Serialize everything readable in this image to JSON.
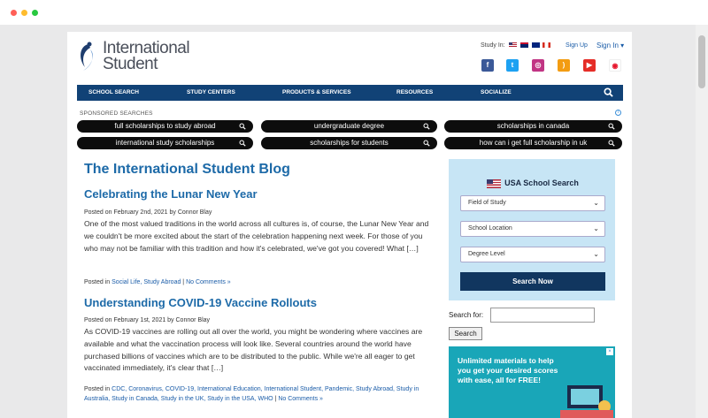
{
  "header": {
    "logo_line1": "International",
    "logo_line2": "Student",
    "study_in_label": "Study In:",
    "sign_up": "Sign Up",
    "sign_in": "Sign In ▾",
    "social": [
      "facebook-icon",
      "twitter-icon",
      "instagram-icon",
      "rss-icon",
      "youtube-icon",
      "weibo-icon"
    ]
  },
  "nav": {
    "items": [
      "SCHOOL SEARCH",
      "STUDY CENTERS",
      "PRODUCTS & SERVICES",
      "RESOURCES",
      "SOCIALIZE"
    ]
  },
  "sponsored": {
    "label": "SPONSORED SEARCHES",
    "pills": [
      "full scholarships to study abroad",
      "undergraduate degree",
      "scholarships in canada",
      "international study scholarships",
      "scholarships for students",
      "how can i get full scholarship in uk"
    ]
  },
  "blog": {
    "title": "The International Student Blog",
    "posts": [
      {
        "title": "Celebrating the Lunar New Year",
        "meta": "Posted on February 2nd, 2021 by Connor Blay",
        "body": "One of the most valued traditions in the world across all cultures is, of course, the Lunar New Year and we couldn't be more excited about the start of the celebration happening next week. For those of you who may not be familiar with this tradition and how it's celebrated, we've got you covered! What […]",
        "posted_in": "Posted in",
        "categories": "Social Life, Study Abroad",
        "comments": "No Comments »"
      },
      {
        "title": "Understanding COVID-19 Vaccine Rollouts",
        "meta": "Posted on February 1st, 2021 by Connor Blay",
        "body": "As COVID-19 vaccines are rolling out all over the world, you might be wondering where vaccines are available and what the vaccination process will look like. Several countries around the world have purchased billions of vaccines which are to be distributed to the public. While we're all eager to get vaccinated immediately, it's clear that […]",
        "posted_in": "Posted in",
        "categories": "CDC, Coronavirus, COVID-19, International Education, International Student, Pandemic, Study Abroad, Study in Australia, Study in Canada, Study in the UK, Study in the USA, WHO",
        "comments": "No Comments »"
      }
    ]
  },
  "widget": {
    "title": "USA School Search",
    "field_of_study": "Field of Study",
    "school_location": "School Location",
    "degree_level": "Degree Level",
    "button": "Search Now"
  },
  "sidebar_search": {
    "label": "Search for:",
    "value": "",
    "button": "Search"
  },
  "ad": {
    "text": "Unlimited materials to help you get your desired scores with ease, all for FREE!"
  },
  "colors": {
    "nav": "#114276",
    "link": "#1d6aa8",
    "widget_bg": "#c7e5f5",
    "ad_bg": "#19a6b8"
  }
}
